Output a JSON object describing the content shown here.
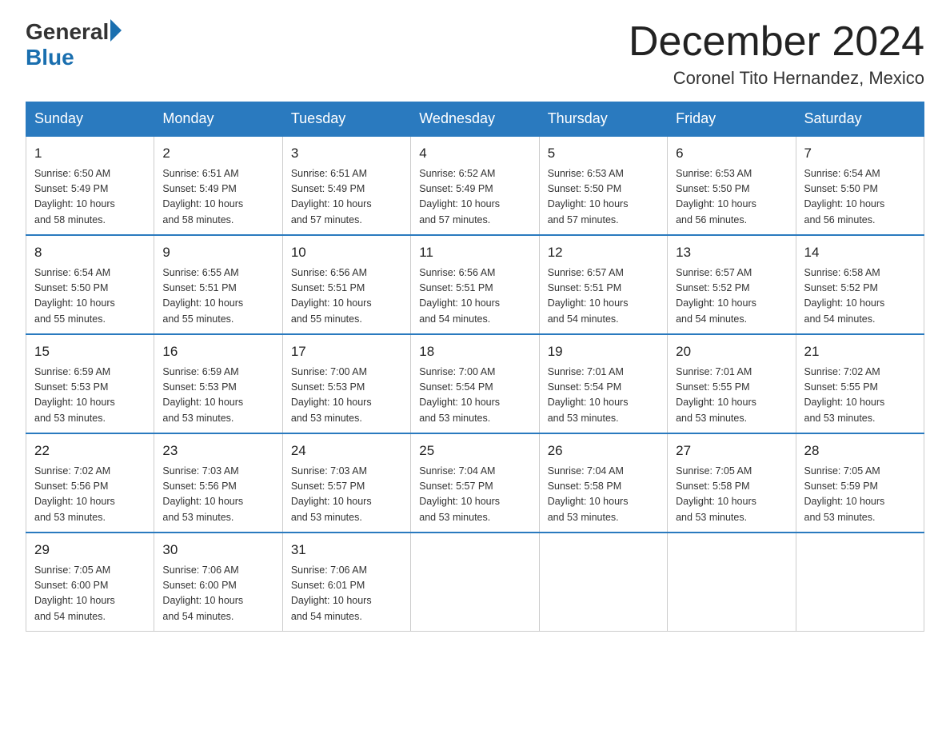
{
  "header": {
    "logo_general": "General",
    "logo_blue": "Blue",
    "month_year": "December 2024",
    "location": "Coronel Tito Hernandez, Mexico"
  },
  "days_of_week": [
    "Sunday",
    "Monday",
    "Tuesday",
    "Wednesday",
    "Thursday",
    "Friday",
    "Saturday"
  ],
  "weeks": [
    [
      {
        "day": "1",
        "sunrise": "6:50 AM",
        "sunset": "5:49 PM",
        "daylight": "10 hours and 58 minutes."
      },
      {
        "day": "2",
        "sunrise": "6:51 AM",
        "sunset": "5:49 PM",
        "daylight": "10 hours and 58 minutes."
      },
      {
        "day": "3",
        "sunrise": "6:51 AM",
        "sunset": "5:49 PM",
        "daylight": "10 hours and 57 minutes."
      },
      {
        "day": "4",
        "sunrise": "6:52 AM",
        "sunset": "5:49 PM",
        "daylight": "10 hours and 57 minutes."
      },
      {
        "day": "5",
        "sunrise": "6:53 AM",
        "sunset": "5:50 PM",
        "daylight": "10 hours and 57 minutes."
      },
      {
        "day": "6",
        "sunrise": "6:53 AM",
        "sunset": "5:50 PM",
        "daylight": "10 hours and 56 minutes."
      },
      {
        "day": "7",
        "sunrise": "6:54 AM",
        "sunset": "5:50 PM",
        "daylight": "10 hours and 56 minutes."
      }
    ],
    [
      {
        "day": "8",
        "sunrise": "6:54 AM",
        "sunset": "5:50 PM",
        "daylight": "10 hours and 55 minutes."
      },
      {
        "day": "9",
        "sunrise": "6:55 AM",
        "sunset": "5:51 PM",
        "daylight": "10 hours and 55 minutes."
      },
      {
        "day": "10",
        "sunrise": "6:56 AM",
        "sunset": "5:51 PM",
        "daylight": "10 hours and 55 minutes."
      },
      {
        "day": "11",
        "sunrise": "6:56 AM",
        "sunset": "5:51 PM",
        "daylight": "10 hours and 54 minutes."
      },
      {
        "day": "12",
        "sunrise": "6:57 AM",
        "sunset": "5:51 PM",
        "daylight": "10 hours and 54 minutes."
      },
      {
        "day": "13",
        "sunrise": "6:57 AM",
        "sunset": "5:52 PM",
        "daylight": "10 hours and 54 minutes."
      },
      {
        "day": "14",
        "sunrise": "6:58 AM",
        "sunset": "5:52 PM",
        "daylight": "10 hours and 54 minutes."
      }
    ],
    [
      {
        "day": "15",
        "sunrise": "6:59 AM",
        "sunset": "5:53 PM",
        "daylight": "10 hours and 53 minutes."
      },
      {
        "day": "16",
        "sunrise": "6:59 AM",
        "sunset": "5:53 PM",
        "daylight": "10 hours and 53 minutes."
      },
      {
        "day": "17",
        "sunrise": "7:00 AM",
        "sunset": "5:53 PM",
        "daylight": "10 hours and 53 minutes."
      },
      {
        "day": "18",
        "sunrise": "7:00 AM",
        "sunset": "5:54 PM",
        "daylight": "10 hours and 53 minutes."
      },
      {
        "day": "19",
        "sunrise": "7:01 AM",
        "sunset": "5:54 PM",
        "daylight": "10 hours and 53 minutes."
      },
      {
        "day": "20",
        "sunrise": "7:01 AM",
        "sunset": "5:55 PM",
        "daylight": "10 hours and 53 minutes."
      },
      {
        "day": "21",
        "sunrise": "7:02 AM",
        "sunset": "5:55 PM",
        "daylight": "10 hours and 53 minutes."
      }
    ],
    [
      {
        "day": "22",
        "sunrise": "7:02 AM",
        "sunset": "5:56 PM",
        "daylight": "10 hours and 53 minutes."
      },
      {
        "day": "23",
        "sunrise": "7:03 AM",
        "sunset": "5:56 PM",
        "daylight": "10 hours and 53 minutes."
      },
      {
        "day": "24",
        "sunrise": "7:03 AM",
        "sunset": "5:57 PM",
        "daylight": "10 hours and 53 minutes."
      },
      {
        "day": "25",
        "sunrise": "7:04 AM",
        "sunset": "5:57 PM",
        "daylight": "10 hours and 53 minutes."
      },
      {
        "day": "26",
        "sunrise": "7:04 AM",
        "sunset": "5:58 PM",
        "daylight": "10 hours and 53 minutes."
      },
      {
        "day": "27",
        "sunrise": "7:05 AM",
        "sunset": "5:58 PM",
        "daylight": "10 hours and 53 minutes."
      },
      {
        "day": "28",
        "sunrise": "7:05 AM",
        "sunset": "5:59 PM",
        "daylight": "10 hours and 53 minutes."
      }
    ],
    [
      {
        "day": "29",
        "sunrise": "7:05 AM",
        "sunset": "6:00 PM",
        "daylight": "10 hours and 54 minutes."
      },
      {
        "day": "30",
        "sunrise": "7:06 AM",
        "sunset": "6:00 PM",
        "daylight": "10 hours and 54 minutes."
      },
      {
        "day": "31",
        "sunrise": "7:06 AM",
        "sunset": "6:01 PM",
        "daylight": "10 hours and 54 minutes."
      },
      null,
      null,
      null,
      null
    ]
  ],
  "labels": {
    "sunrise": "Sunrise:",
    "sunset": "Sunset:",
    "daylight": "Daylight:"
  }
}
